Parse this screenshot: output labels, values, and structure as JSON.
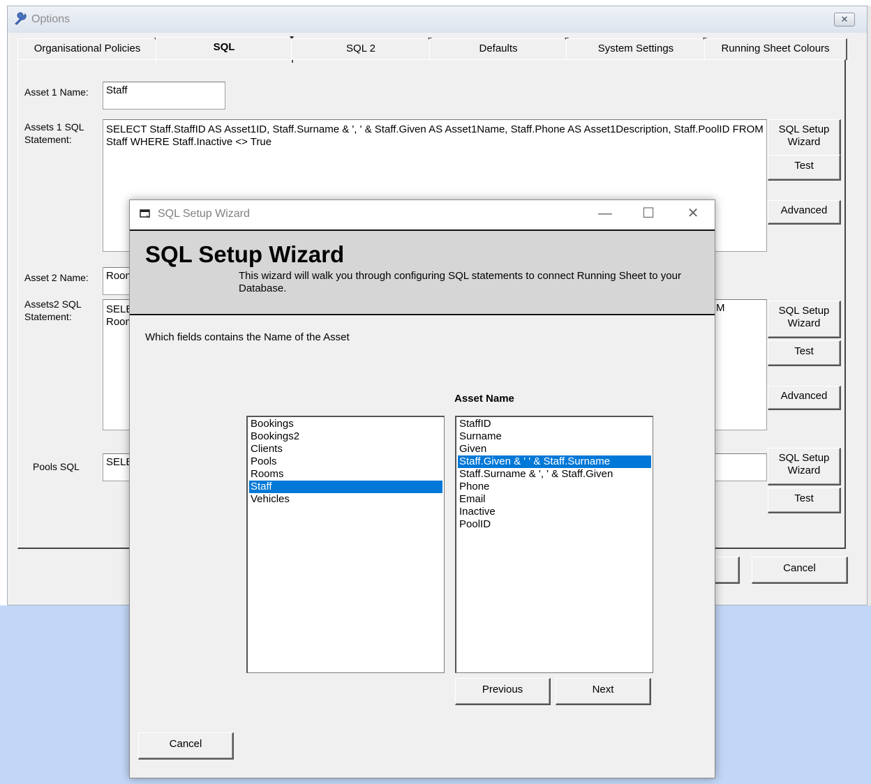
{
  "options": {
    "title": "Options",
    "close_glyph": "✕",
    "tabs": [
      "Organisational Policies",
      "SQL",
      "SQL 2",
      "Defaults",
      "System Settings",
      "Running Sheet Colours"
    ],
    "active_tab": "SQL",
    "asset1_label": "Asset 1 Name:",
    "asset1_value": "Staff",
    "assets1_sql_label": "Assets 1 SQL Statement:",
    "assets1_sql_value": "SELECT Staff.StaffID AS Asset1ID, Staff.Surname & ', ' & Staff.Given AS Asset1Name, Staff.Phone AS Asset1Description, Staff.PoolID FROM Staff WHERE Staff.Inactive <> True",
    "asset2_label": "Asset 2 Name:",
    "asset2_value": "Room",
    "assets2_sql_label": "Assets2 SQL Statement:",
    "assets2_sql_line1": "SELE",
    "assets2_sql_line2": "Room",
    "assets2_sql_tail": "M",
    "pools_sql_label": "Pools SQL",
    "pools_sql_value": "SELE",
    "sql_setup_wizard_label": "SQL Setup Wizard",
    "test_label": "Test",
    "advanced_label": "Advanced",
    "cancel_label": "Cancel"
  },
  "wizard": {
    "title": "SQL Setup Wizard",
    "heading": "SQL Setup Wizard",
    "description": "This wizard will walk you through configuring SQL statements to connect Running Sheet to your Database.",
    "prompt": "Which fields contains the Name of the Asset",
    "asset_name_label": "Asset Name",
    "tables": [
      "Bookings",
      "Bookings2",
      "Clients",
      "Pools",
      "Rooms",
      "Staff",
      "Vehicles"
    ],
    "selected_table": "Staff",
    "fields": [
      "StaffID",
      "Surname",
      "Given",
      "Staff.Given & ' ' & Staff.Surname",
      "Staff.Surname & ', ' & Staff.Given",
      "Phone",
      "Email",
      "Inactive",
      "PoolID"
    ],
    "selected_field": "Staff.Given & ' ' & Staff.Surname",
    "previous_label": "Previous",
    "next_label": "Next",
    "cancel_label": "Cancel",
    "minimize_glyph": "—",
    "maximize_glyph": "☐",
    "close_glyph": "✕"
  }
}
